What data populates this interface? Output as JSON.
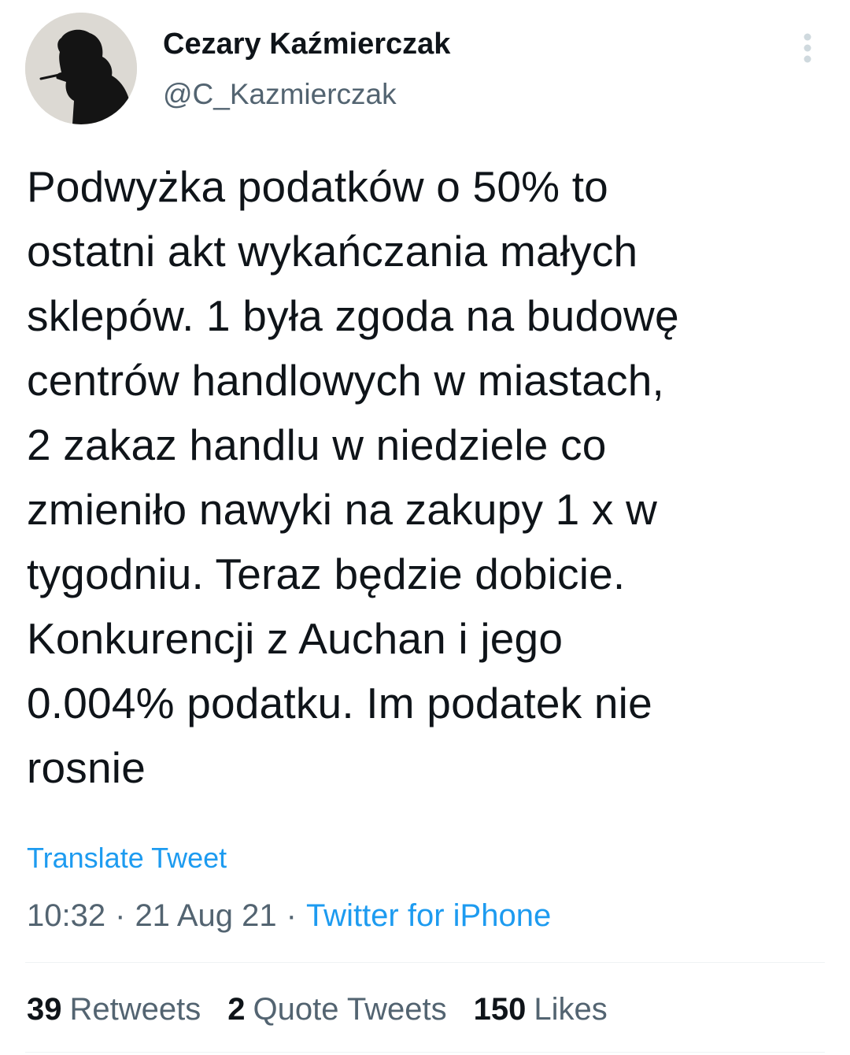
{
  "author": {
    "name": "Cezary Kaźmierczak",
    "handle": "@C_Kazmierczak",
    "avatar_icon": "profile-silhouette-avatar"
  },
  "tweet": {
    "text": "Podwyżka podatków o 50% to\nostatni akt wykańczania małych\nsklepów. 1 była zgoda na budowę\ncentrów handlowych w miastach,\n2 zakaz handlu w niedziele co\nzmieniło nawyki na zakupy 1 x w\ntygodniu. Teraz będzie dobicie.\nKonkurencji z Auchan i jego\n0.004% podatku. Im podatek nie\nrosnie",
    "translate_label": "Translate Tweet",
    "time": "10:32",
    "separator": "·",
    "date": "21 Aug 21",
    "source": "Twitter for iPhone"
  },
  "stats": {
    "retweets": {
      "count": "39",
      "label": "Retweets"
    },
    "quote_tweets": {
      "count": "2",
      "label": "Quote Tweets"
    },
    "likes": {
      "count": "150",
      "label": "Likes"
    }
  },
  "icons": {
    "more": "more-vertical-icon"
  },
  "colors": {
    "text": "#0f1419",
    "secondary": "#536471",
    "link": "#1d9bf0",
    "divider": "#eff3f4",
    "more_icon": "#cfd9de"
  }
}
